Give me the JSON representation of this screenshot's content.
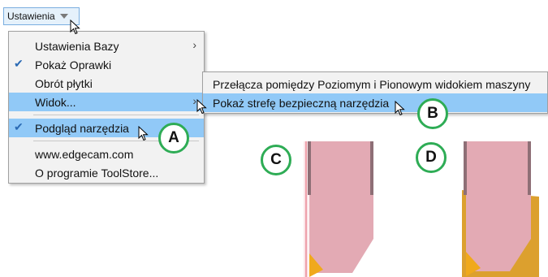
{
  "menu_button": {
    "label": "Ustawienia",
    "icon": "caret-down-icon"
  },
  "main_menu": {
    "items": [
      {
        "label": "Ustawienia Bazy",
        "checked": false,
        "submenu": true
      },
      {
        "label": "Pokaż Oprawki",
        "checked": true,
        "submenu": false
      },
      {
        "label": "Obrót płytki",
        "checked": false,
        "submenu": false
      },
      {
        "label": "Widok...",
        "checked": false,
        "submenu": true,
        "highlighted": true
      },
      {
        "label": "Podgląd narzędzia",
        "checked": true,
        "submenu": false,
        "highlighted": true
      },
      {
        "label": "www.edgecam.com",
        "checked": false,
        "submenu": false
      },
      {
        "label": "O programie ToolStore...",
        "checked": false,
        "submenu": false
      }
    ]
  },
  "sub_menu": {
    "items": [
      {
        "label": "Przełącza pomiędzy  Poziomym i Pionowym widokiem maszyny"
      },
      {
        "label": "Pokaż strefę bezpieczną narzędzia",
        "highlighted": true
      }
    ]
  },
  "callouts": {
    "a": "A",
    "b": "B",
    "c": "C",
    "d": "D"
  },
  "colors": {
    "highlight": "#91c9f7",
    "badge_border": "#2eac55",
    "tool_body": "#e3aab4",
    "insert": "#f0a91c",
    "safety_zone": "#dca02e",
    "holder_edge": "#8e6f76"
  }
}
